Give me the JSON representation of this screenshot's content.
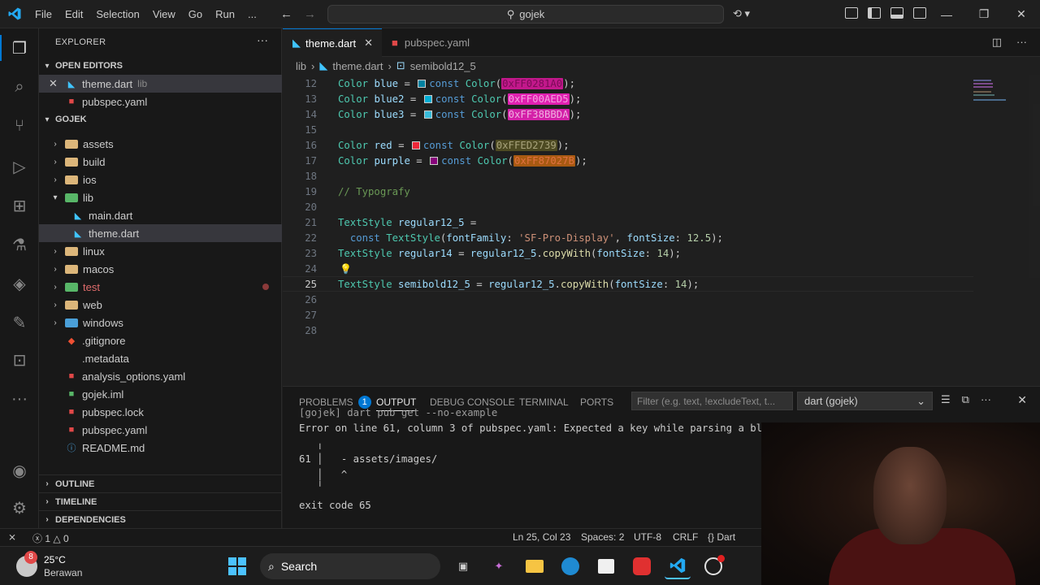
{
  "menu": [
    "File",
    "Edit",
    "Selection",
    "View",
    "Go",
    "Run",
    "..."
  ],
  "command_center": "gojek",
  "explorer": {
    "title": "EXPLORER",
    "open_editors_label": "OPEN EDITORS",
    "open_editors": [
      {
        "name": "theme.dart",
        "folder": "lib",
        "selected": true
      },
      {
        "name": "pubspec.yaml",
        "folder": "",
        "selected": false
      }
    ],
    "project_label": "GOJEK",
    "tree": [
      {
        "name": "assets",
        "type": "folder",
        "expanded": false
      },
      {
        "name": "build",
        "type": "folder",
        "expanded": false
      },
      {
        "name": "ios",
        "type": "folder",
        "expanded": false
      },
      {
        "name": "lib",
        "type": "folder",
        "expanded": true
      },
      {
        "name": "main.dart",
        "type": "dart",
        "indent": 2
      },
      {
        "name": "theme.dart",
        "type": "dart",
        "indent": 2,
        "selected": true
      },
      {
        "name": "linux",
        "type": "folder",
        "expanded": false
      },
      {
        "name": "macos",
        "type": "folder",
        "expanded": false
      },
      {
        "name": "test",
        "type": "folder",
        "expanded": false,
        "modified": true
      },
      {
        "name": "web",
        "type": "folder",
        "expanded": false
      },
      {
        "name": "windows",
        "type": "folder",
        "expanded": false
      },
      {
        "name": ".gitignore",
        "type": "git"
      },
      {
        "name": ".metadata",
        "type": "plain"
      },
      {
        "name": "analysis_options.yaml",
        "type": "yaml"
      },
      {
        "name": "gojek.iml",
        "type": "iml"
      },
      {
        "name": "pubspec.lock",
        "type": "yaml"
      },
      {
        "name": "pubspec.yaml",
        "type": "yaml"
      },
      {
        "name": "README.md",
        "type": "info"
      }
    ],
    "bottom_sections": [
      "OUTLINE",
      "TIMELINE",
      "DEPENDENCIES"
    ]
  },
  "tabs": [
    {
      "label": "theme.dart",
      "active": true
    },
    {
      "label": "pubspec.yaml",
      "active": false
    }
  ],
  "breadcrumb": [
    "lib",
    "theme.dart",
    "semibold12_5"
  ],
  "editor": {
    "line_numbers": [
      "12",
      "13",
      "14",
      "15",
      "16",
      "17",
      "18",
      "19",
      "20",
      "21",
      "22",
      "23",
      "24",
      "25",
      "26",
      "27",
      "28"
    ],
    "current_line": "25",
    "colors": {
      "blue": "#2B1A6B",
      "blue2": "#00AED5",
      "blue3": "#38BBDA",
      "red": "#ED2739",
      "purple": "#87027B"
    },
    "hex_values": {
      "blue": "0xFF0281A0",
      "blue2": "0xFF00AED5",
      "blue3": "0xFF38BBDA",
      "red": "0xFFED2739",
      "purple": "0xFF87027B"
    }
  },
  "panel": {
    "tabs": [
      "PROBLEMS",
      "OUTPUT",
      "DEBUG CONSOLE",
      "TERMINAL",
      "PORTS"
    ],
    "problems_count": "1",
    "filter_placeholder": "Filter (e.g. text, !excludeText, t...",
    "channel": "dart (gojek)",
    "output_lines": [
      "[gojek] dart pub get --no-example",
      "Error on line 61, column 3 of pubspec.yaml: Expected a key while parsing a block mapping.",
      "   ╷",
      "61 │   - assets/images/",
      "   │   ^",
      "   ╵",
      "exit code 65"
    ]
  },
  "statusbar": {
    "errors": "1",
    "warnings": "0",
    "position": "Ln 25, Col 23",
    "spaces": "Spaces: 2",
    "encoding": "UTF-8",
    "eol": "CRLF",
    "language": "Dart"
  },
  "taskbar": {
    "weather_temp": "25°C",
    "weather_desc": "Berawan",
    "weather_badge": "8",
    "search_label": "Search"
  }
}
